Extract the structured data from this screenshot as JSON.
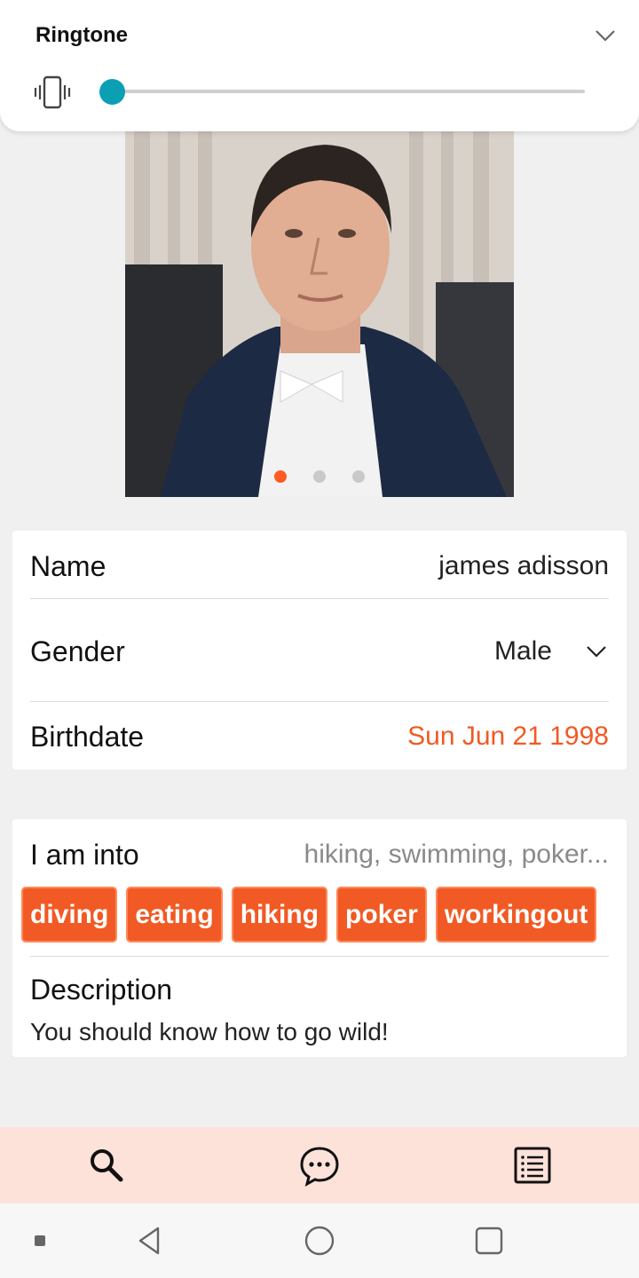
{
  "volume_panel": {
    "title": "Ringtone",
    "volume_level": 0.0,
    "icons": {
      "mode": "vibrate-icon",
      "collapse": "chevron-down-icon"
    },
    "accent_color": "#0b9fb4"
  },
  "carousel": {
    "image": "portrait-photo",
    "page_count": 3,
    "active_index": 0,
    "active_dot_color": "#ff5b24"
  },
  "profile": {
    "name": {
      "label": "Name",
      "value": "james adisson"
    },
    "gender": {
      "label": "Gender",
      "value": "Male"
    },
    "birthdate": {
      "label": "Birthdate",
      "value": "Sun Jun 21 1998",
      "color": "#f15a24"
    }
  },
  "interests": {
    "label": "I am into",
    "summary": "hiking, swimming, poker...",
    "tags": [
      "diving",
      "eating",
      "hiking",
      "poker",
      "workingout"
    ],
    "tag_color": "#f15a24"
  },
  "description": {
    "label": "Description",
    "text": "You should know how to go wild!"
  },
  "bottom_nav": {
    "background": "#fde2da",
    "items": [
      {
        "icon": "search-icon"
      },
      {
        "icon": "chat-icon"
      },
      {
        "icon": "list-icon"
      }
    ]
  },
  "system_nav": {
    "icons": [
      "menu-dot-icon",
      "back-icon",
      "home-icon",
      "recents-icon"
    ]
  }
}
